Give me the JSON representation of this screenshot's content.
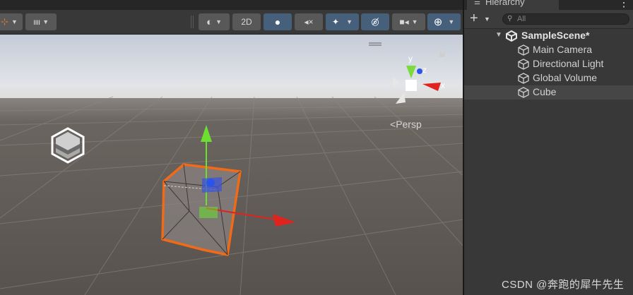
{
  "scene_toolbar": {
    "btn_2d": "2D"
  },
  "scene": {
    "gizmo_axes": {
      "x": "x",
      "y": "y",
      "z": "z"
    },
    "projection_label": "Persp"
  },
  "hierarchy": {
    "tab_label": "Hierarchy",
    "search_placeholder": "All",
    "scene_name": "SampleScene*",
    "items": [
      {
        "label": "Main Camera"
      },
      {
        "label": "Directional Light"
      },
      {
        "label": "Global Volume"
      },
      {
        "label": "Cube",
        "selected": true
      }
    ]
  },
  "watermark": "CSDN @奔跑的犀牛先生",
  "colors": {
    "selection_outline": "#f06a17",
    "x_axis": "#e0231c",
    "y_axis": "#6be030",
    "z_axis": "#2a55e8",
    "active_button": "#46607c",
    "panel_bg": "#383838",
    "sky_top": "#d7dde6",
    "ground": "#5e5955"
  }
}
